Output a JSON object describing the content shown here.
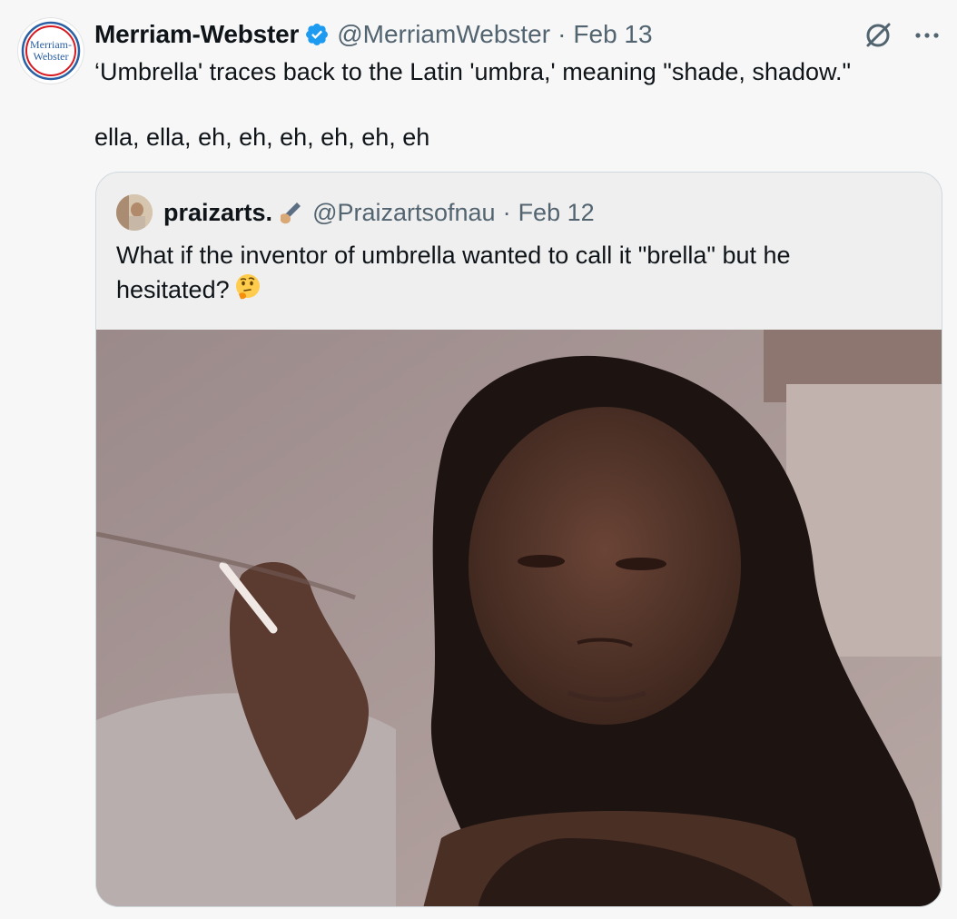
{
  "tweet": {
    "author": {
      "display_name": "Merriam-Webster",
      "handle": "@MerriamWebster",
      "date": "Feb 13",
      "logo_text_line1": "Merriam-",
      "logo_text_line2": "Webster"
    },
    "separator": "·",
    "body_line1": "‘Umbrella' traces back to the Latin 'umbra,' meaning \"shade, shadow.\"",
    "body_line2": "ella, ella, eh, eh, eh, eh, eh, eh",
    "actions": {
      "grok_icon": "grok-icon",
      "more_icon": "more-icon"
    }
  },
  "quote": {
    "display_name": "praizarts.",
    "handle": "@Praizartsofnau",
    "date": "Feb 12",
    "separator": "·",
    "emoji_name": "writing-hand-icon",
    "text": "What if the inventor of umbrella wanted to call it \"brella\" but he hesitated?",
    "trailing_emoji": "thinking-face-icon"
  },
  "colors": {
    "verified_blue": "#1d9bf0",
    "secondary_text": "#536471",
    "mw_red": "#d71920",
    "mw_blue": "#2a5fa3"
  }
}
